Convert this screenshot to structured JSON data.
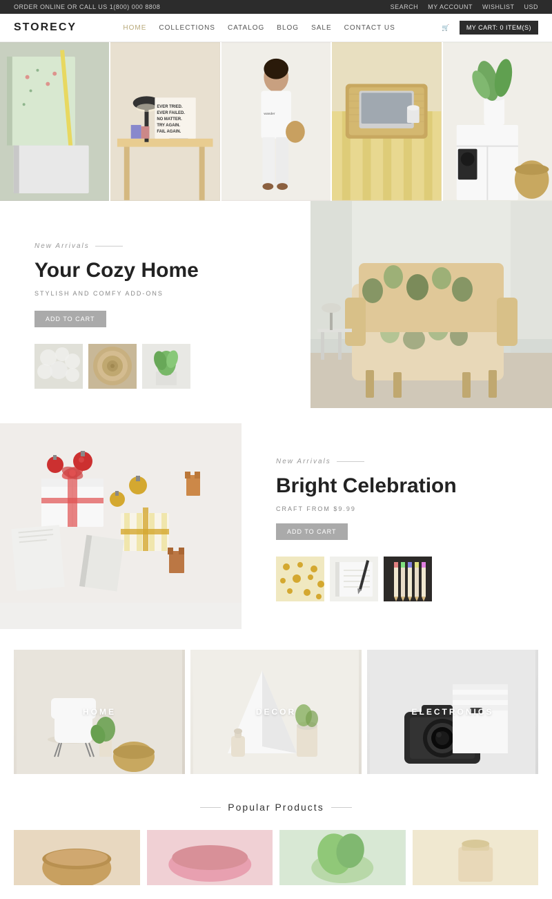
{
  "topbar": {
    "left_text": "ORDER ONLINE OR CALL US 1(800) 000 8808",
    "search_label": "SEARCH",
    "account_label": "MY ACCOUNT",
    "wishlist_label": "WISHLIST",
    "currency_label": "USD"
  },
  "nav": {
    "logo": "STORECY",
    "links": [
      {
        "label": "HOME",
        "active": true
      },
      {
        "label": "COLLECTIONS",
        "active": false
      },
      {
        "label": "CATALOG",
        "active": false
      },
      {
        "label": "BLOG",
        "active": false
      },
      {
        "label": "SALE",
        "active": false
      },
      {
        "label": "CONTACT US",
        "active": false
      }
    ],
    "cart_label": "MY CART: 0 ITEM(S)"
  },
  "hero_mosaic": {
    "tiles": [
      {
        "id": 1,
        "alt": "notebooks pattern"
      },
      {
        "id": 2,
        "alt": "desk with lamp",
        "has_text": true,
        "text": "EVER TRIED.\nEVER FAILED.\nNO MATTER.\nTRY AGAIN.\nFAIL AGAIN.\nFAIL BETTER."
      },
      {
        "id": 3,
        "alt": "woman in white"
      },
      {
        "id": 4,
        "alt": "laptop on tray"
      },
      {
        "id": 5,
        "alt": "plant on shelf"
      }
    ]
  },
  "cozy_section": {
    "new_arrivals": "New Arrivals",
    "title": "Your Cozy Home",
    "subtitle": "STYLISH AND COMFY ADD-ONS",
    "btn_label": "ADD TO CART",
    "thumbnails": [
      {
        "id": 1,
        "alt": "white fluffy texture"
      },
      {
        "id": 2,
        "alt": "wooden circle board"
      },
      {
        "id": 3,
        "alt": "plant on shelf"
      }
    ],
    "main_img_alt": "floral armchair"
  },
  "bright_section": {
    "new_arrivals": "New Arrivals",
    "title": "Bright Celebration",
    "subtitle": "CRAFT FROM $9.99",
    "btn_label": "ADD TO CART",
    "thumbnails": [
      {
        "id": 1,
        "alt": "gold polka dots"
      },
      {
        "id": 2,
        "alt": "notebook with pen"
      },
      {
        "id": 3,
        "alt": "pencils and pens"
      }
    ],
    "main_img_alt": "gift packages with ribbons"
  },
  "categories": [
    {
      "label": "HOME",
      "bg_class": "cat-home"
    },
    {
      "label": "DECOR",
      "bg_class": "cat-decor"
    },
    {
      "label": "ELECTRONICS",
      "bg_class": "cat-electronics"
    }
  ],
  "popular_section": {
    "title": "Popular Products"
  }
}
